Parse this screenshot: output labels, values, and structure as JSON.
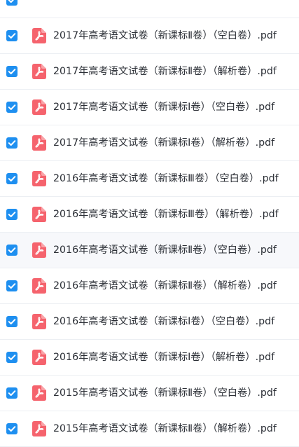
{
  "colors": {
    "checkbox_checked": "#1e8ff0",
    "pdf_icon": "#f5636d",
    "row_divider": "#eceff3",
    "row_hover": "#f7f8fb",
    "text": "#2b2f36"
  },
  "icons": {
    "checkbox": "checkmark-icon",
    "file": "pdf-file-icon"
  },
  "files": [
    {
      "name": "2017年高考语文试卷（新课标Ⅱ卷）（空白卷）.pdf",
      "checked": true
    },
    {
      "name": "2017年高考语文试卷（新课标Ⅱ卷）（解析卷）.pdf",
      "checked": true
    },
    {
      "name": "2017年高考语文试卷（新课标Ⅰ卷）（空白卷）.pdf",
      "checked": true
    },
    {
      "name": "2017年高考语文试卷（新课标Ⅰ卷）（解析卷）.pdf",
      "checked": true
    },
    {
      "name": "2016年高考语文试卷（新课标Ⅲ卷）（空白卷）.pdf",
      "checked": true
    },
    {
      "name": "2016年高考语文试卷（新课标Ⅲ卷）（解析卷）.pdf",
      "checked": true
    },
    {
      "name": "2016年高考语文试卷（新课标Ⅱ卷）（空白卷）.pdf",
      "checked": true,
      "hovered": true
    },
    {
      "name": "2016年高考语文试卷（新课标Ⅱ卷）（解析卷）.pdf",
      "checked": true
    },
    {
      "name": "2016年高考语文试卷（新课标Ⅰ卷）（空白卷）.pdf",
      "checked": true
    },
    {
      "name": "2016年高考语文试卷（新课标Ⅰ卷）（解析卷）.pdf",
      "checked": true
    },
    {
      "name": "2015年高考语文试卷（新课标Ⅱ卷）（空白卷）.pdf",
      "checked": true
    },
    {
      "name": "2015年高考语文试卷（新课标Ⅱ卷）（解析卷）.pdf",
      "checked": true
    }
  ]
}
